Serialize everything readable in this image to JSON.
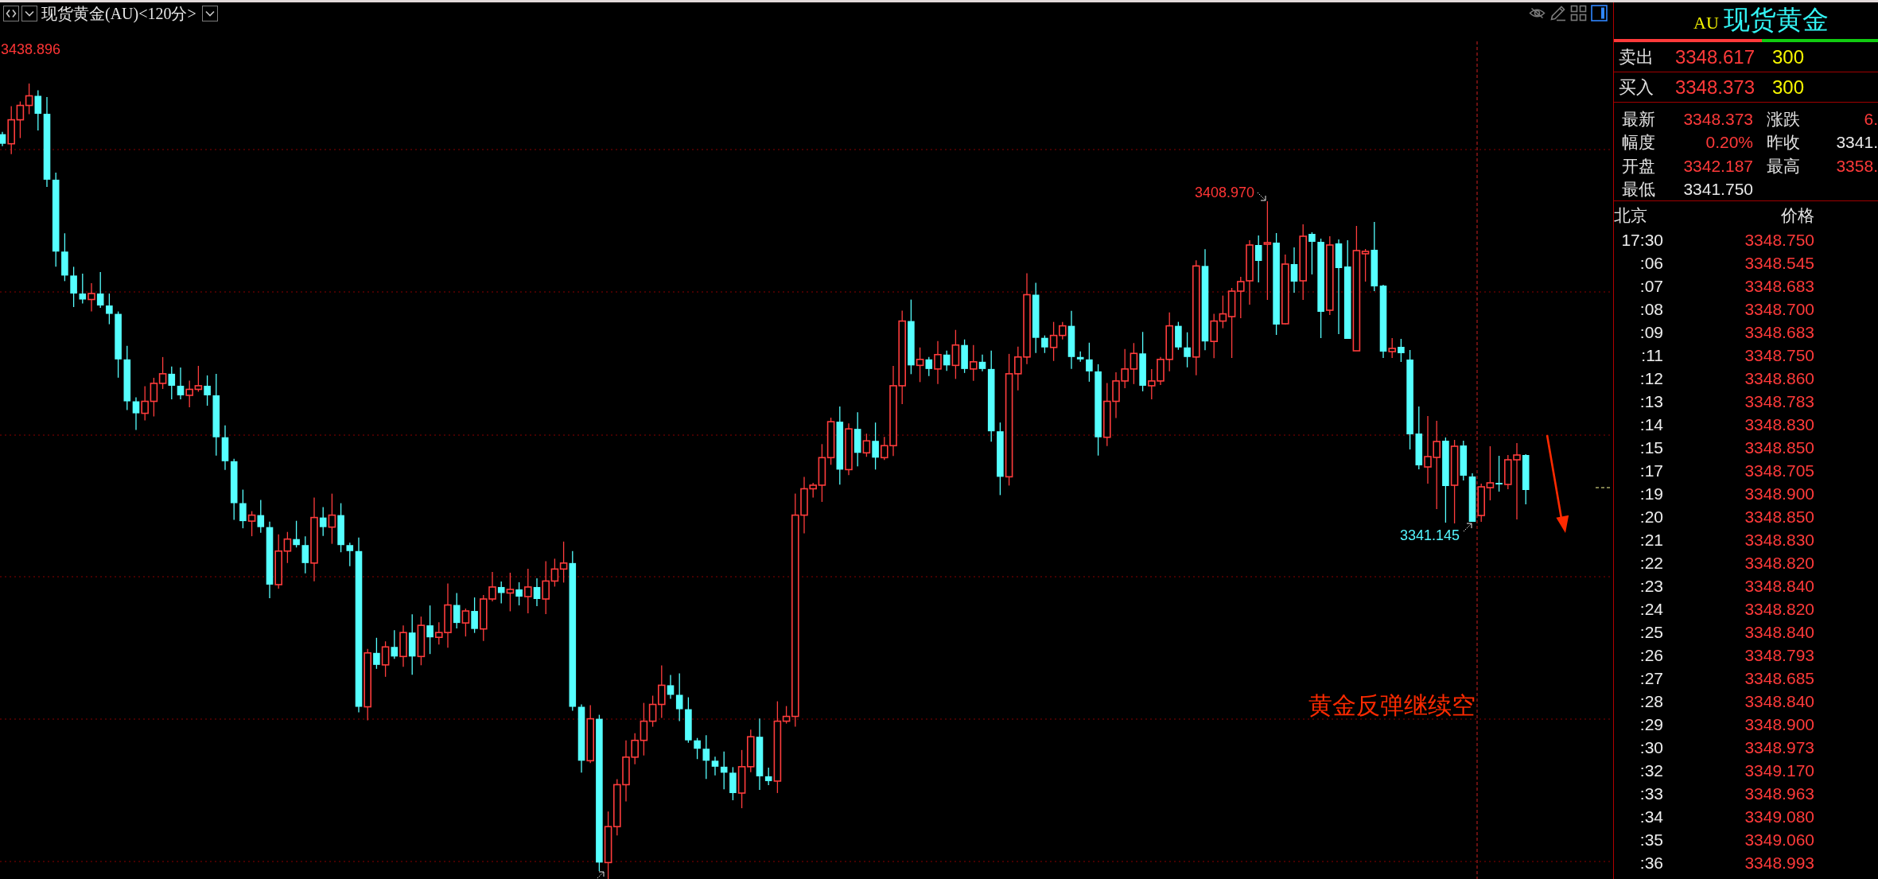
{
  "chart_header": {
    "title": "现货黄金(AU)<120分>",
    "panel_toggle": {
      "on": true
    }
  },
  "chart": {
    "price_labels": [
      {
        "text": "3438.896",
        "kind": "high"
      },
      {
        "text": "3408.970",
        "kind": "high"
      },
      {
        "text": "3341.145",
        "kind": "low"
      }
    ],
    "annotation": "黄金反弹继续空"
  },
  "quote_panel": {
    "code": "AU",
    "name": "现货黄金",
    "balance_bar": {
      "level": 0.56
    },
    "orders": [
      {
        "label": "卖出",
        "price": "3348.617",
        "volume": "300"
      },
      {
        "label": "买入",
        "price": "3348.373",
        "volume": "300"
      }
    ],
    "stats": [
      {
        "label": "最新",
        "value": "3348.373",
        "color": "#ff3a3a"
      },
      {
        "label": "涨跌",
        "value": "6.",
        "color": "#ff3a3a"
      },
      {
        "label": "幅度",
        "value": "0.20%",
        "color": "#ff3a3a"
      },
      {
        "label": "昨收",
        "value": "3341.",
        "color": "#e8e8e8"
      },
      {
        "label": "开盘",
        "value": "3342.187",
        "color": "#ff3a3a"
      },
      {
        "label": "最高",
        "value": "3358.",
        "color": "#ff3a3a"
      },
      {
        "label": "最低",
        "value": "3341.750",
        "color": "#e8e8e8"
      }
    ],
    "ticks": {
      "columns": [
        "北京",
        "价格"
      ],
      "rows": [
        {
          "time": "17:30",
          "price": "3348.750"
        },
        {
          "time": ":06",
          "price": "3348.545"
        },
        {
          "time": ":07",
          "price": "3348.683"
        },
        {
          "time": ":08",
          "price": "3348.700"
        },
        {
          "time": ":09",
          "price": "3348.683"
        },
        {
          "time": ":11",
          "price": "3348.750"
        },
        {
          "time": ":12",
          "price": "3348.860"
        },
        {
          "time": ":13",
          "price": "3348.783"
        },
        {
          "time": ":14",
          "price": "3348.830"
        },
        {
          "time": ":15",
          "price": "3348.850"
        },
        {
          "time": ":17",
          "price": "3348.705"
        },
        {
          "time": ":19",
          "price": "3348.900"
        },
        {
          "time": ":20",
          "price": "3348.850"
        },
        {
          "time": ":21",
          "price": "3348.830"
        },
        {
          "time": ":22",
          "price": "3348.820"
        },
        {
          "time": ":23",
          "price": "3348.840"
        },
        {
          "time": ":24",
          "price": "3348.820"
        },
        {
          "time": ":25",
          "price": "3348.840"
        },
        {
          "time": ":26",
          "price": "3348.793"
        },
        {
          "time": ":27",
          "price": "3348.685"
        },
        {
          "time": ":28",
          "price": "3348.840"
        },
        {
          "time": ":29",
          "price": "3348.900"
        },
        {
          "time": ":30",
          "price": "3348.973"
        },
        {
          "time": ":32",
          "price": "3349.170"
        },
        {
          "time": ":33",
          "price": "3348.963"
        },
        {
          "time": ":34",
          "price": "3349.080"
        },
        {
          "time": ":35",
          "price": "3349.060"
        },
        {
          "time": ":36",
          "price": "3348.993"
        }
      ]
    }
  }
}
